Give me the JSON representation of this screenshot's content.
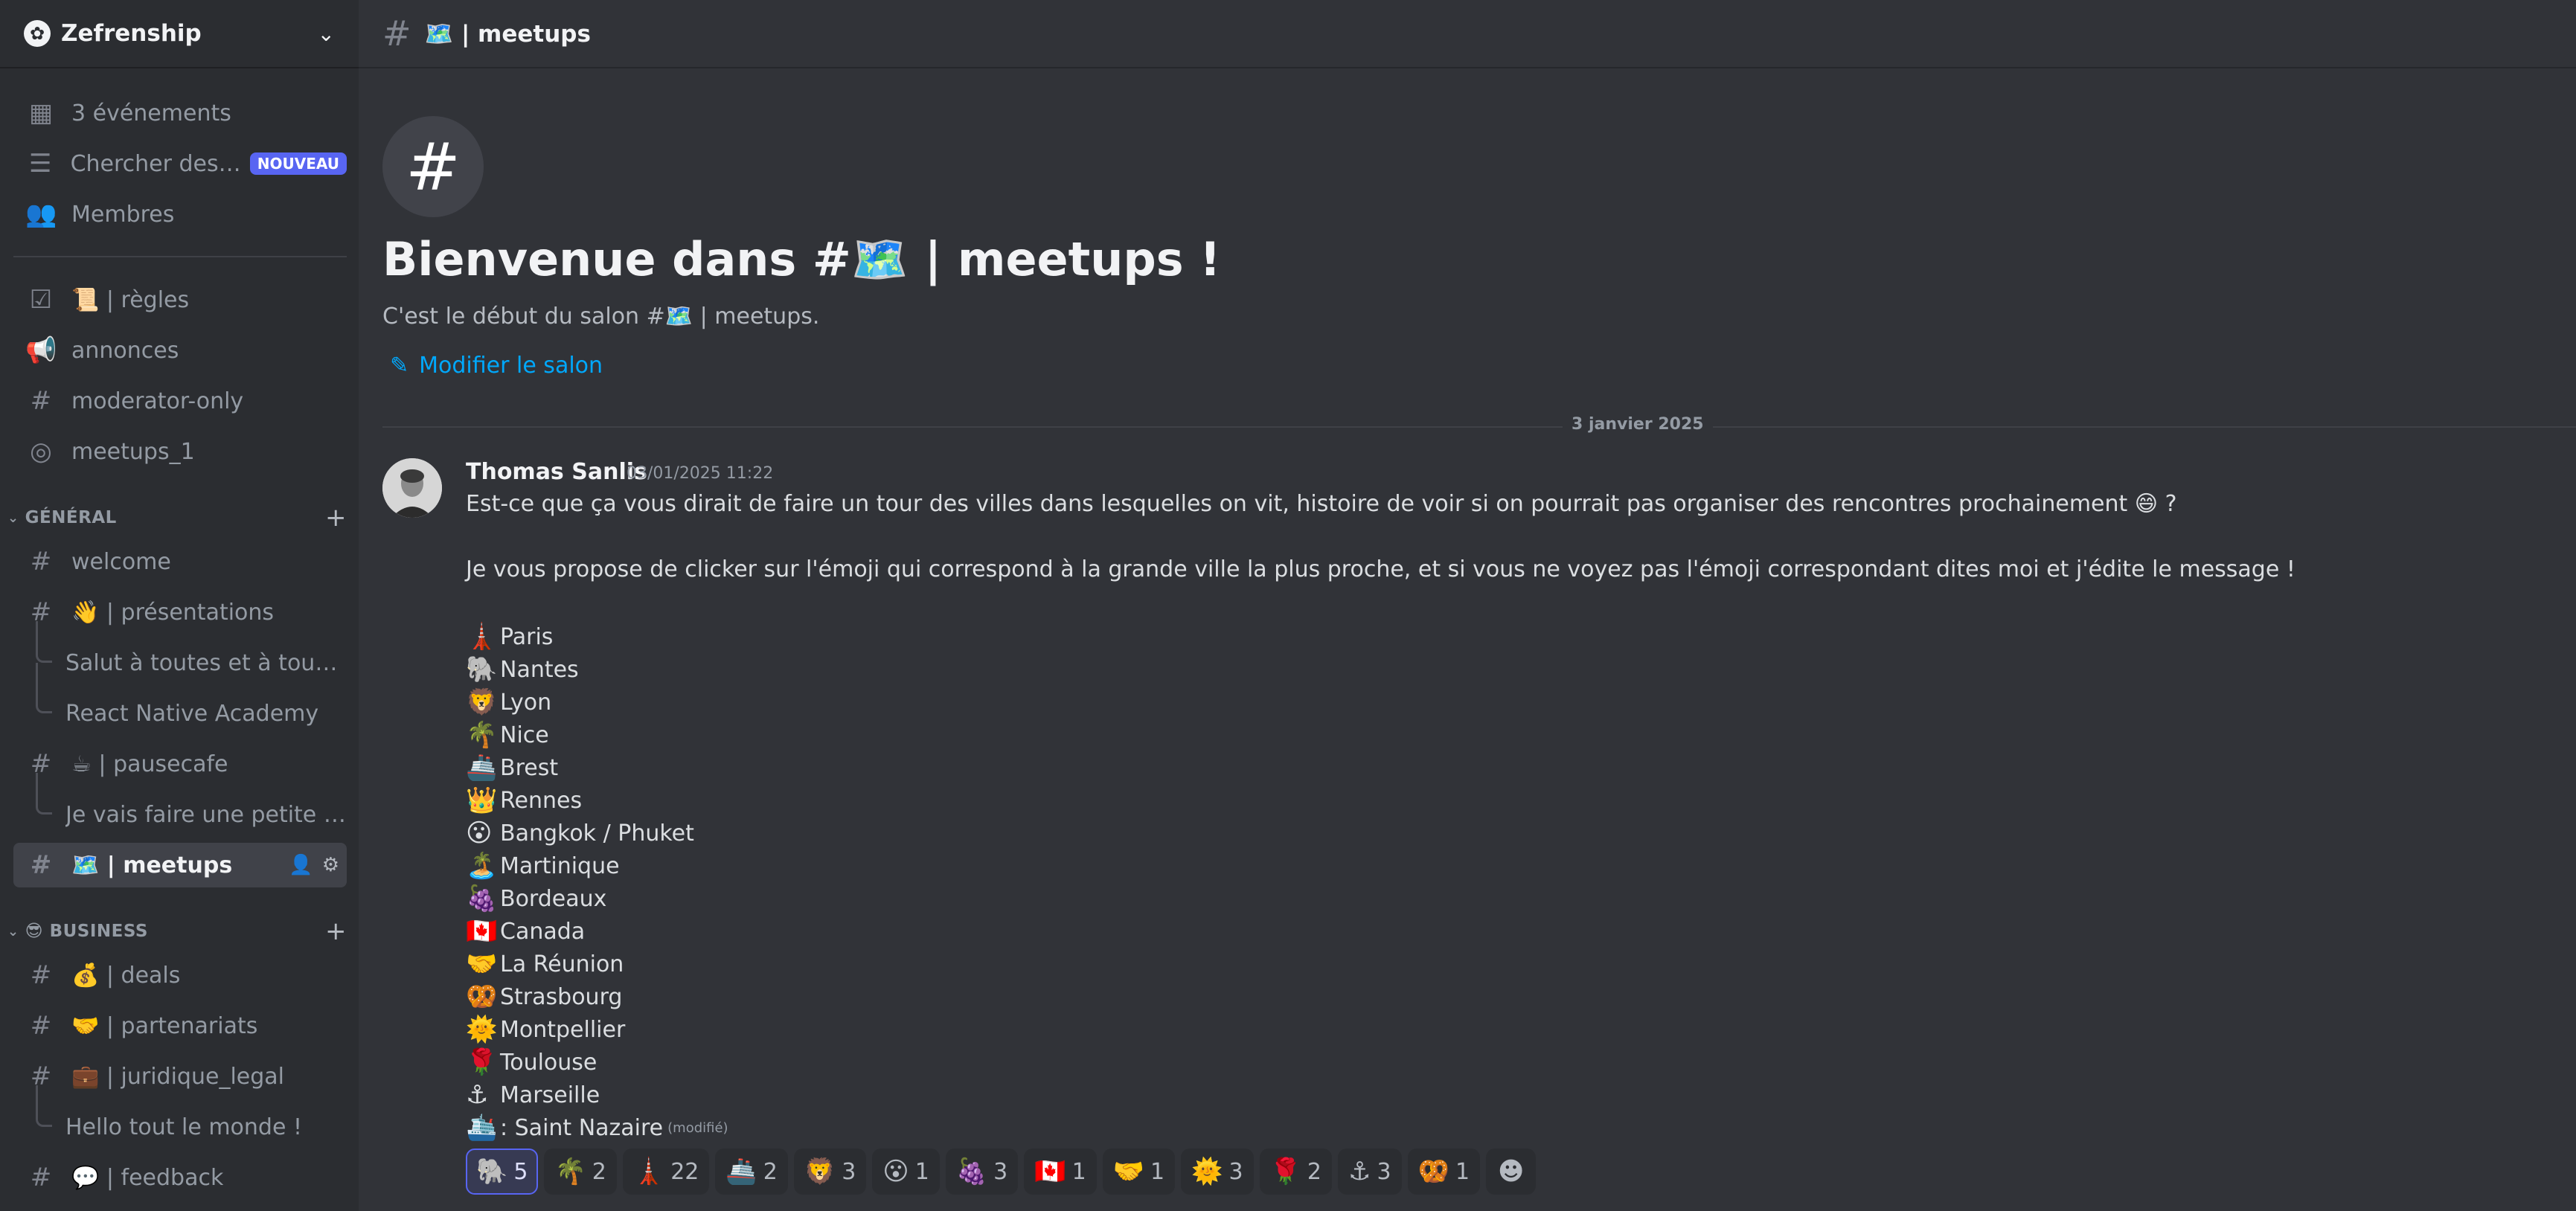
{
  "server": {
    "name": "Zefrenship",
    "icon": "server-icon",
    "chevron": "⌄"
  },
  "sidebar": {
    "top_items": [
      {
        "label": "3 événements",
        "icon": "calendar-icon",
        "glyph": "▦"
      },
      {
        "label": "Chercher des ...",
        "icon": "search-list-icon",
        "glyph": "☰",
        "badge": "NOUVEAU"
      },
      {
        "label": "Membres",
        "icon": "members-icon",
        "glyph": "👥"
      }
    ],
    "channels": [
      {
        "label": "📜 | règles",
        "icon": "rules-icon",
        "glyph": "☑"
      },
      {
        "label": "annonces",
        "icon": "megaphone-icon",
        "glyph": "📢"
      },
      {
        "label": "moderator-only",
        "icon": "private-hash-icon",
        "glyph": "#"
      },
      {
        "label": "meetups_1",
        "icon": "stage-icon",
        "glyph": "◎"
      }
    ],
    "categories": [
      {
        "name": "GÉNÉRAL",
        "items": [
          {
            "label": "welcome",
            "type": "channel"
          },
          {
            "label": "👋 | présentations",
            "type": "channel"
          },
          {
            "label": "Salut à toutes et à tous ...",
            "type": "thread"
          },
          {
            "label": "React Native Academy",
            "type": "thread"
          },
          {
            "label": "☕ | pausecafe",
            "type": "channel"
          },
          {
            "label": "Je vais faire une petite l...",
            "type": "thread"
          },
          {
            "label": "🗺️ | meetups",
            "type": "channel",
            "active": true
          }
        ]
      },
      {
        "name": "😎 BUSINESS",
        "items": [
          {
            "label": "💰 | deals",
            "type": "channel"
          },
          {
            "label": "🤝 | partenariats",
            "type": "channel"
          },
          {
            "label": "💼 | juridique_legal",
            "type": "channel"
          },
          {
            "label": "Hello tout le monde !",
            "type": "thread"
          },
          {
            "label": "💬 | feedback",
            "type": "channel"
          }
        ]
      }
    ]
  },
  "topbar": {
    "title": "🗺️ | meetups"
  },
  "welcome": {
    "title": "Bienvenue dans #🗺️ | meetups !",
    "subtitle": "C'est le début du salon #🗺️ | meetups.",
    "edit_label": "Modifier le salon"
  },
  "date_divider": "3 janvier 2025",
  "message": {
    "author": "Thomas Sanlis",
    "timestamp": "03/01/2025 11:22",
    "line1": "Est-ce que ça vous dirait de faire un tour des villes dans lesquelles on vit, histoire de voir si on pourrait pas organiser des rencontres prochainement 😄 ?",
    "line2": "Je vous propose de clicker sur l'émoji qui correspond à la grande ville la plus proche, et si vous ne voyez pas l'émoji correspondant dites moi et j'édite le message !",
    "cities": [
      {
        "emoji": "🗼",
        "name": "Paris"
      },
      {
        "emoji": "🐘",
        "name": "Nantes"
      },
      {
        "emoji": "🦁",
        "name": "Lyon"
      },
      {
        "emoji": "🌴",
        "name": "Nice"
      },
      {
        "emoji": "🚢",
        "name": "Brest"
      },
      {
        "emoji": "👑",
        "name": "Rennes"
      },
      {
        "emoji": "😮",
        "name": "Bangkok / Phuket"
      },
      {
        "emoji": "🏝️",
        "name": "Martinique"
      },
      {
        "emoji": "🍇",
        "name": "Bordeaux"
      },
      {
        "emoji": "🇨🇦",
        "name": "Canada"
      },
      {
        "emoji": "🤝",
        "name": "La Réunion"
      },
      {
        "emoji": "🥨",
        "name": "Strasbourg"
      },
      {
        "emoji": "🌞",
        "name": "Montpellier"
      },
      {
        "emoji": "🌹",
        "name": "Toulouse"
      },
      {
        "emoji": "⚓",
        "name": "Marseille"
      },
      {
        "emoji": "🛳️",
        "name": ": Saint Nazaire"
      }
    ],
    "edited_label": "(modifié)",
    "reactions": [
      {
        "emoji": "🐘",
        "count": "5",
        "me": true
      },
      {
        "emoji": "🌴",
        "count": "2"
      },
      {
        "emoji": "🗼",
        "count": "22"
      },
      {
        "emoji": "🚢",
        "count": "2"
      },
      {
        "emoji": "🦁",
        "count": "3"
      },
      {
        "emoji": "😮",
        "count": "1"
      },
      {
        "emoji": "🍇",
        "count": "3"
      },
      {
        "emoji": "🇨🇦",
        "count": "1"
      },
      {
        "emoji": "🤝",
        "count": "1"
      },
      {
        "emoji": "🌞",
        "count": "3"
      },
      {
        "emoji": "🌹",
        "count": "2"
      },
      {
        "emoji": "⚓",
        "count": "3"
      },
      {
        "emoji": "🥨",
        "count": "1"
      }
    ],
    "add_reaction_icon": "add-reaction-icon"
  },
  "colors": {
    "background": "#313338",
    "sidebar": "#2b2d31",
    "accent": "#5865f2",
    "link": "#00a8fc"
  }
}
